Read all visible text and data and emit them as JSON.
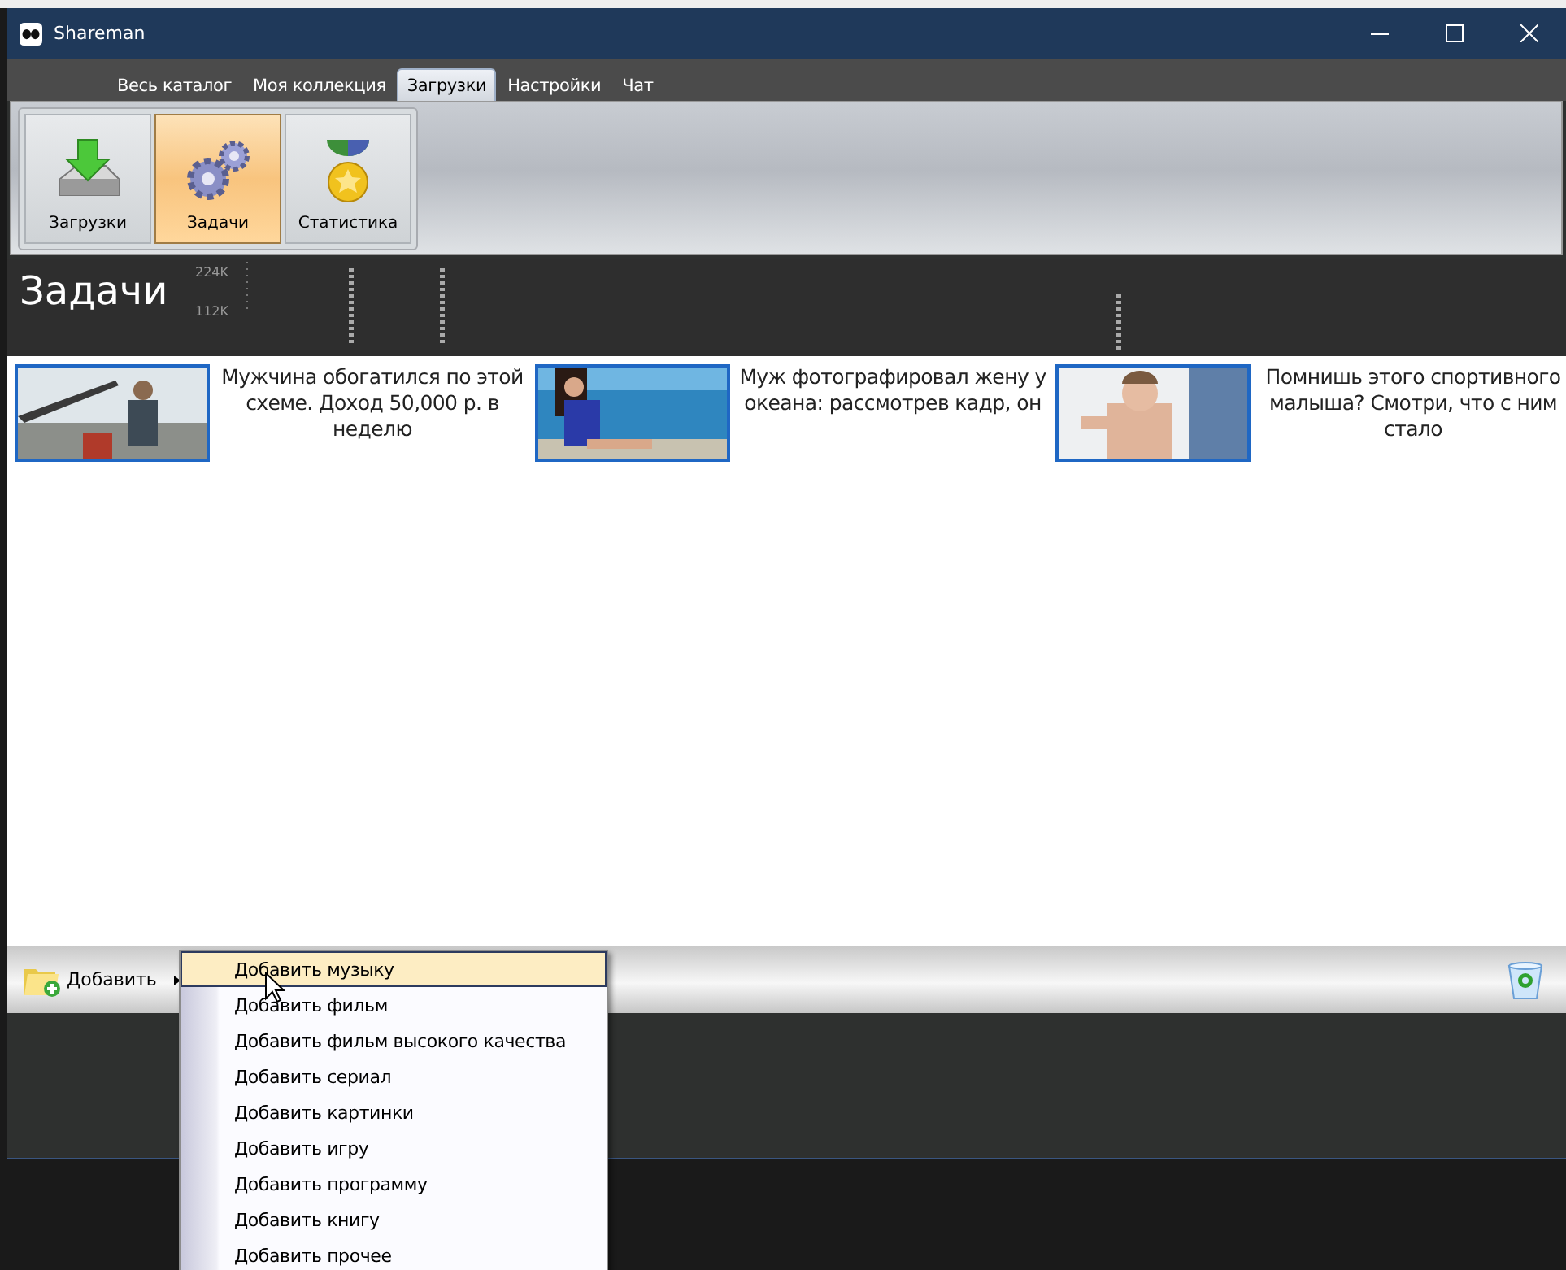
{
  "window": {
    "title": "Shareman"
  },
  "tabs": [
    {
      "label": "Весь каталог",
      "selected": false
    },
    {
      "label": "Моя коллекция",
      "selected": false
    },
    {
      "label": "Загрузки",
      "selected": true
    },
    {
      "label": "Настройки",
      "selected": false
    },
    {
      "label": "Чат",
      "selected": false
    }
  ],
  "ribbon": [
    {
      "label": "Загрузки",
      "kind": "download",
      "selected": false
    },
    {
      "label": "Задачи",
      "kind": "gears",
      "selected": true
    },
    {
      "label": "Статистика",
      "kind": "medal",
      "selected": false
    }
  ],
  "section": {
    "title": "Задачи",
    "graph_labels": [
      "224K",
      "112K"
    ]
  },
  "ads": [
    {
      "kind": "picture",
      "text": "Мужчина обогатился по этой схеме. Доход 50,000 р. в неделю"
    },
    {
      "kind": "picture",
      "text": "Муж фотографировал жену у океана: рассмотрев кадр, он"
    },
    {
      "kind": "picture",
      "text": "Помнишь этого спортивного малыша? Смотри, что с ним стало"
    }
  ],
  "toolbar": {
    "add_label": "Добавить"
  },
  "menu": [
    {
      "label": "Добавить музыку",
      "selected": true
    },
    {
      "label": "Добавить фильм",
      "selected": false
    },
    {
      "label": "Добавить фильм высокого качества",
      "selected": false
    },
    {
      "label": "Добавить сериал",
      "selected": false
    },
    {
      "label": "Добавить картинки",
      "selected": false
    },
    {
      "label": "Добавить игру",
      "selected": false
    },
    {
      "label": "Добавить программу",
      "selected": false
    },
    {
      "label": "Добавить книгу",
      "selected": false
    },
    {
      "label": "Добавить прочее",
      "selected": false
    }
  ]
}
